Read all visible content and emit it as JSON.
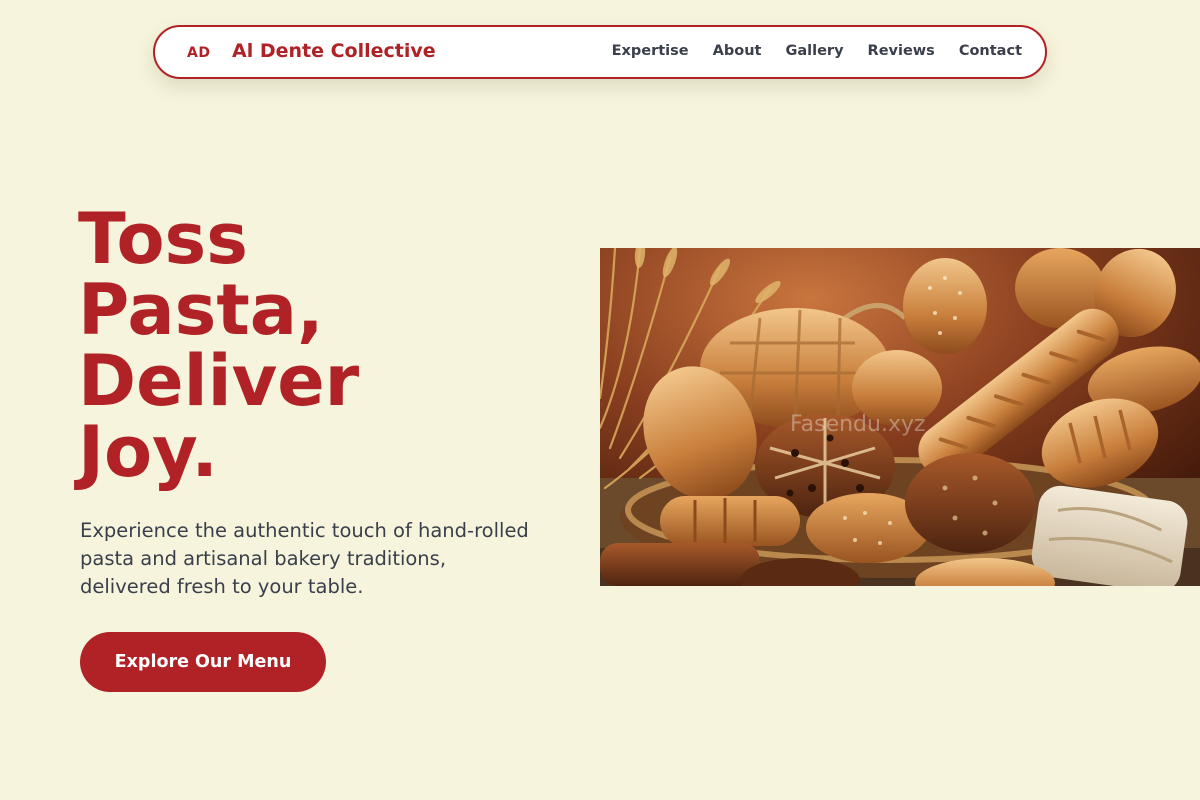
{
  "nav": {
    "logo_mark": "AD",
    "brand_name": "Al Dente Collective",
    "links": [
      "Expertise",
      "About",
      "Gallery",
      "Reviews",
      "Contact"
    ]
  },
  "hero": {
    "title_lines": [
      "Toss",
      "Pasta,",
      "Deliver",
      "Joy."
    ],
    "description": "Experience the authentic touch of hand-rolled pasta and artisanal bakery traditions, delivered fresh to your table.",
    "cta_label": "Explore Our Menu",
    "image_watermark": "Fasendu.xyz"
  },
  "colors": {
    "brand_red": "#b02226",
    "background": "#f6f4dc",
    "text_dark": "#3a3f4b"
  }
}
